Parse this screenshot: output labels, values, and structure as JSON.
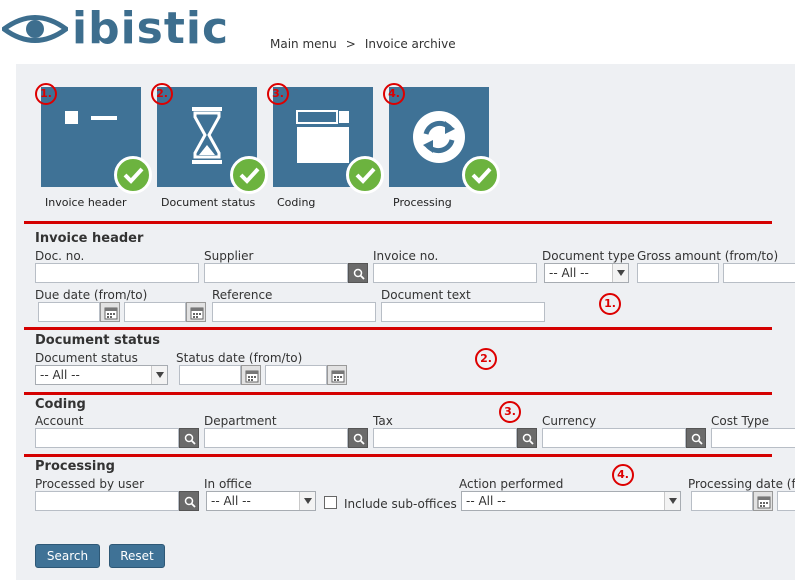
{
  "logo": {
    "wordmark": "ibistic"
  },
  "breadcrumb": {
    "items": [
      "Main menu",
      "Invoice archive"
    ],
    "separator": ">"
  },
  "tiles": [
    {
      "label": "Invoice header",
      "badge": "1."
    },
    {
      "label": "Document status",
      "badge": "2."
    },
    {
      "label": "Coding",
      "badge": "3."
    },
    {
      "label": "Processing",
      "badge": "4."
    }
  ],
  "sections": {
    "invoice_header": {
      "title": "Invoice header",
      "badge": "1.",
      "fields": {
        "doc_no": "Doc. no.",
        "supplier": "Supplier",
        "invoice_no": "Invoice no.",
        "document_type": "Document type",
        "document_type_value": "-- All --",
        "gross_amount": "Gross amount (from/to)",
        "due_date": "Due date (from/to)",
        "reference": "Reference",
        "document_text": "Document text"
      }
    },
    "document_status": {
      "title": "Document status",
      "badge": "2.",
      "fields": {
        "document_status": "Document status",
        "document_status_value": "-- All --",
        "status_date": "Status date (from/to)"
      }
    },
    "coding": {
      "title": "Coding",
      "badge": "3.",
      "fields": {
        "account": "Account",
        "department": "Department",
        "tax": "Tax",
        "currency": "Currency",
        "cost_type": "Cost Type"
      }
    },
    "processing": {
      "title": "Processing",
      "badge": "4.",
      "fields": {
        "processed_by_user": "Processed by user",
        "in_office": "In office",
        "in_office_value": "-- All --",
        "include_sub_offices": "Include sub-offices",
        "action_performed": "Action performed",
        "action_performed_value": "-- All --",
        "processing_date": "Processing date (from"
      }
    }
  },
  "buttons": {
    "search": "Search",
    "reset": "Reset"
  },
  "colors": {
    "brand": "#3f7296",
    "check": "#6cb33f",
    "annotation_red": "#d40000",
    "panel_bg": "#eef0f3"
  }
}
